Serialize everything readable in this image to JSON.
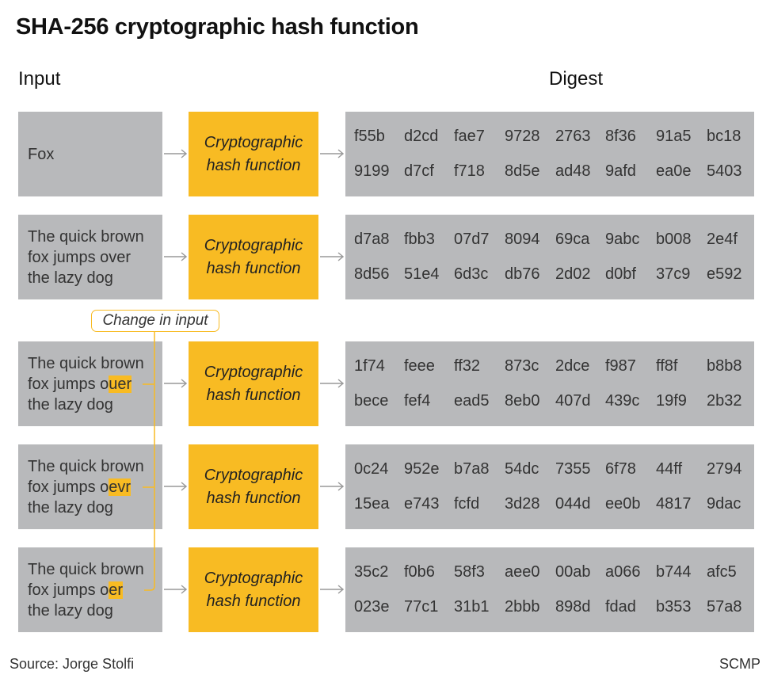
{
  "title": "SHA-256 cryptographic hash function",
  "headers": {
    "input": "Input",
    "digest": "Digest"
  },
  "hash_label_line1": "Cryptographic",
  "hash_label_line2": "hash function",
  "change_label": "Change in input",
  "rows": [
    {
      "input_lines": [
        [
          "Fox",
          ""
        ]
      ],
      "digest": [
        [
          "f55b",
          "d2cd",
          "fae7",
          "9728",
          "2763",
          "8f36",
          "91a5",
          "bc18"
        ],
        [
          "9199",
          "d7cf",
          "f718",
          "8d5e",
          "ad48",
          "9afd",
          "ea0e",
          "5403"
        ]
      ]
    },
    {
      "input_lines": [
        [
          "The quick brown",
          ""
        ],
        [
          "fox jumps over",
          ""
        ],
        [
          "the lazy dog",
          ""
        ]
      ],
      "digest": [
        [
          "d7a8",
          "fbb3",
          "07d7",
          "8094",
          "69ca",
          "9abc",
          "b008",
          "2e4f"
        ],
        [
          "8d56",
          "51e4",
          "6d3c",
          "db76",
          "2d02",
          "d0bf",
          "37c9",
          "e592"
        ]
      ]
    },
    {
      "input_lines": [
        [
          "The quick brown",
          ""
        ],
        [
          "fox jumps o",
          "uer"
        ],
        [
          "the lazy dog",
          ""
        ]
      ],
      "digest": [
        [
          "1f74",
          "feee",
          "ff32",
          "873c",
          "2dce",
          "f987",
          "ff8f",
          "b8b8"
        ],
        [
          "bece",
          "fef4",
          "ead5",
          "8eb0",
          "407d",
          "439c",
          "19f9",
          "2b32"
        ]
      ]
    },
    {
      "input_lines": [
        [
          "The quick brown",
          ""
        ],
        [
          "fox jumps o",
          "evr"
        ],
        [
          "the lazy dog",
          ""
        ]
      ],
      "digest": [
        [
          "0c24",
          "952e",
          "b7a8",
          "54dc",
          "7355",
          "6f78",
          "44ff",
          "2794"
        ],
        [
          "15ea",
          "e743",
          "fcfd",
          "3d28",
          "044d",
          "ee0b",
          "4817",
          "9dac"
        ]
      ]
    },
    {
      "input_lines": [
        [
          "The quick brown",
          ""
        ],
        [
          "fox jumps o",
          "er"
        ],
        [
          "the lazy dog",
          ""
        ]
      ],
      "digest": [
        [
          "35c2",
          "f0b6",
          "58f3",
          "aee0",
          "00ab",
          "a066",
          "b744",
          "afc5"
        ],
        [
          "023e",
          "77c1",
          "31b1",
          "2bbb",
          "898d",
          "fdad",
          "b353",
          "57a8"
        ]
      ]
    }
  ],
  "footer": {
    "source": "Source: Jorge Stolfi",
    "credit": "SCMP"
  },
  "colors": {
    "highlight": "#f8bb23",
    "box_gray": "#b8b9bb",
    "arrow": "#999999"
  }
}
